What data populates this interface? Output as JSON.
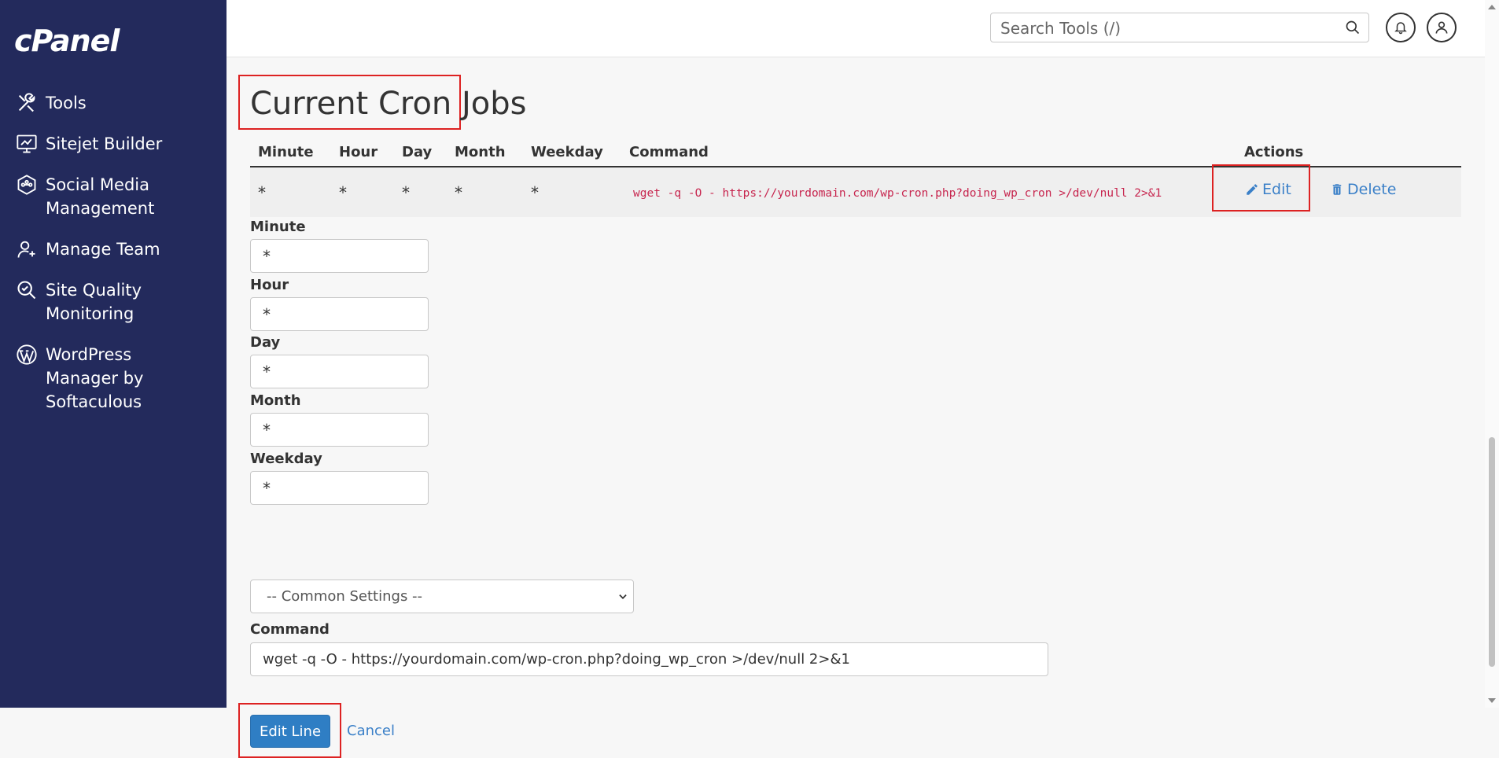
{
  "sidebar": {
    "logo": "cPanel",
    "items": [
      {
        "label": "Tools",
        "icon": "tools-icon"
      },
      {
        "label": "Sitejet Builder",
        "icon": "monitor-icon"
      },
      {
        "label": "Social Media\nManagement",
        "icon": "network-icon"
      },
      {
        "label": "Manage Team",
        "icon": "team-icon"
      },
      {
        "label": "Site Quality\nMonitoring",
        "icon": "magnifier-check-icon"
      },
      {
        "label": " WordPress\n  Manager by\nSoftaculous",
        "icon": "wordpress-icon"
      }
    ]
  },
  "header": {
    "search_placeholder": "Search Tools (/)"
  },
  "main": {
    "title": "Current Cron Jobs",
    "table": {
      "headers": [
        "Minute",
        "Hour",
        "Day",
        "Month",
        "Weekday",
        "Command",
        "Actions"
      ],
      "row": {
        "minute": "*",
        "hour": "*",
        "day": "*",
        "month": "*",
        "weekday": "*",
        "command": "wget -q -O - https://yourdomain.com/wp-cron.php?doing_wp_cron >/dev/null 2>&1",
        "edit_label": "Edit",
        "delete_label": "Delete"
      }
    },
    "form": {
      "minute_label": "Minute",
      "minute_value": "*",
      "hour_label": "Hour",
      "hour_value": "*",
      "day_label": "Day",
      "day_value": "*",
      "month_label": "Month",
      "month_value": "*",
      "weekday_label": "Weekday",
      "weekday_value": "*",
      "common_settings": "-- Common Settings --",
      "command_label": "Command",
      "command_value": "wget -q -O - https://yourdomain.com/wp-cron.php?doing_wp_cron >/dev/null 2>&1",
      "submit_label": "Edit Line",
      "cancel_label": "Cancel"
    }
  },
  "colors": {
    "sidebar_bg": "#232a5c",
    "link": "#3b80c8",
    "primary_button": "#2f7ec4",
    "command_text": "#c7254e",
    "highlight": "#d22222"
  }
}
